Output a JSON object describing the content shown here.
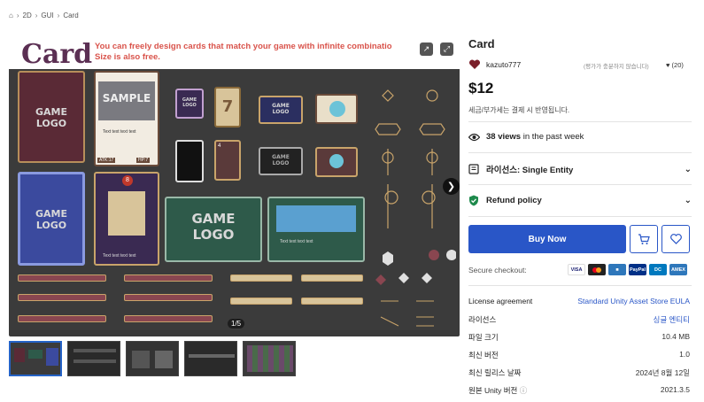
{
  "breadcrumb": {
    "home_icon": "home-icon",
    "items": [
      "2D",
      "GUI",
      "Card"
    ]
  },
  "hero": {
    "title": "Card",
    "subtitle_line1": "You can freely design cards that match your game with infinite combinatio",
    "subtitle_line2": "Size is also free.",
    "counter": "1/5",
    "logo_text_1": "GAME",
    "logo_text_2": "LOGO",
    "sample_text": "SAMPLE",
    "name_label": "Name",
    "skill_label": "Skill",
    "body_text": "Text text text text",
    "atk": "ATK:17",
    "hp": "HP:7",
    "num_7": "7",
    "num_4": "4",
    "num_8": "8",
    "num_777": "777"
  },
  "product": {
    "title": "Card",
    "publisher": "kazuto777",
    "rating_text": "(평가가 충분하지 않습니다)",
    "favorites": "(20)",
    "price": "$12",
    "tax_note": "세금/부가세는 결제 시 반영됩니다.",
    "views_count": "38 views",
    "views_suffix": "in the past week",
    "license_label": "라이선스: Single Entity",
    "refund_label": "Refund policy",
    "buy_label": "Buy Now",
    "secure_label": "Secure checkout:",
    "payments": [
      "VISA",
      "MC",
      "AMEX",
      "PayPal",
      "DC",
      "AMEX"
    ]
  },
  "details": [
    {
      "key": "License agreement",
      "value": "Standard Unity Asset Store EULA",
      "link": true
    },
    {
      "key": "라이선스",
      "value": "싱글 엔티티",
      "link": true
    },
    {
      "key": "파일 크기",
      "value": "10.4 MB",
      "link": false
    },
    {
      "key": "최신 버전",
      "value": "1.0",
      "link": false
    },
    {
      "key": "최신 릴리스 날짜",
      "value": "2024년 8월 12일",
      "link": false
    },
    {
      "key": "원본 Unity 버전",
      "value": "2021.3.5",
      "link": false
    }
  ],
  "colors": {
    "accent": "#2956c7",
    "title_purple": "#5b2f53",
    "subtitle_red": "#d9534b",
    "canvas": "#3b3b3b"
  }
}
